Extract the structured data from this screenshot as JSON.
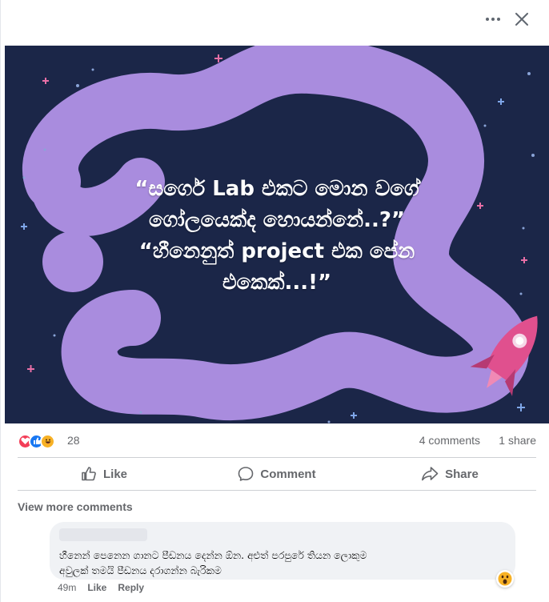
{
  "header": {
    "more_icon": "ellipsis-horizontal-icon",
    "close_icon": "close-icon"
  },
  "post": {
    "image_text": [
      "“සර්ගෙ Lab එකට මොන වගේ",
      "ගෝලයෙක්ද හොයන්නේ..?”",
      "“හීනෙනුත් project එක පේන",
      "එකෙක්...!”"
    ],
    "colors": {
      "background": "#1b2648",
      "shape": "#a98cde",
      "rocket": "#e0508e"
    }
  },
  "stats": {
    "reaction_icons": [
      "love-icon",
      "like-icon",
      "haha-icon"
    ],
    "reaction_count": "28",
    "comments": "4 comments",
    "shares": "1 share"
  },
  "actions": [
    {
      "label": "Like",
      "icon": "thumbs-up-icon"
    },
    {
      "label": "Comment",
      "icon": "comment-bubble-icon"
    },
    {
      "label": "Share",
      "icon": "share-arrow-icon"
    }
  ],
  "comments_section": {
    "view_more": "View more comments",
    "comment": {
      "text_line1": "හීනෙන් පෙනෙන ගානට පීඩනය දෙන්න ඕන. අළුත් පරපුරේ තියන ලොකුම",
      "text_line2": "අවුලක් තමයි පීඩනය දරාගන්න බැරිකම",
      "time": "49m",
      "like": "Like",
      "reply": "Reply",
      "reaction": "wow-icon"
    }
  }
}
